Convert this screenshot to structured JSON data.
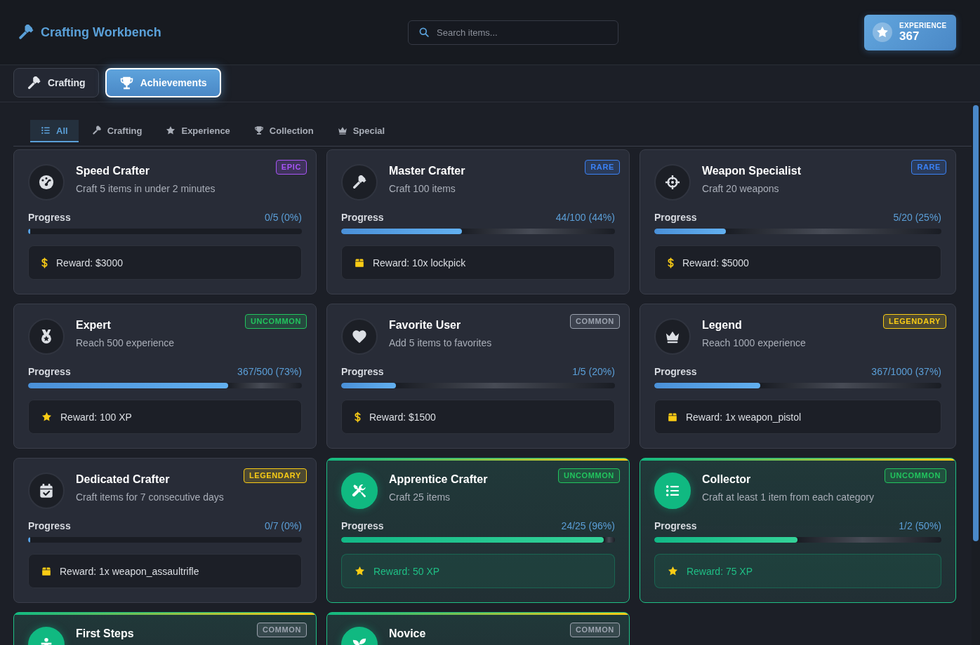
{
  "header": {
    "title": "Crafting Workbench",
    "search": {
      "placeholder": "Search items..."
    },
    "experience": {
      "label": "EXPERIENCE",
      "value": "367"
    }
  },
  "nav_tabs": [
    {
      "label": "Crafting",
      "selected": false
    },
    {
      "label": "Achievements",
      "selected": true
    }
  ],
  "filter_tabs": [
    {
      "label": "All",
      "selected": true
    },
    {
      "label": "Crafting",
      "selected": false
    },
    {
      "label": "Experience",
      "selected": false
    },
    {
      "label": "Collection",
      "selected": false
    },
    {
      "label": "Special",
      "selected": false
    }
  ],
  "achievements": [
    {
      "title": "Speed Crafter",
      "description": "Craft 5 items in under 2 minutes",
      "badge": {
        "text": "EPIC",
        "color": "#a855f7"
      },
      "highlighted": false,
      "progress": {
        "label": "Progress",
        "value": "0/5 (0%)",
        "level": 0
      },
      "reward": {
        "kind": "money",
        "text": "Reward: $3000"
      }
    },
    {
      "title": "Master Crafter",
      "description": "Craft 100 items",
      "badge": {
        "text": "RARE",
        "color": "#3b82f6"
      },
      "highlighted": false,
      "progress": {
        "label": "Progress",
        "value": "44/100 (44%)",
        "level": 0.44
      },
      "reward": {
        "kind": "item",
        "text": "Reward: 10x lockpick"
      }
    },
    {
      "title": "Weapon Specialist",
      "description": "Craft 20 weapons",
      "badge": {
        "text": "RARE",
        "color": "#3b82f6"
      },
      "highlighted": false,
      "progress": {
        "label": "Progress",
        "value": "5/20 (25%)",
        "level": 0.25
      },
      "reward": {
        "kind": "money",
        "text": "Reward: $5000"
      }
    },
    {
      "title": "Expert",
      "description": "Reach 500 experience",
      "badge": {
        "text": "UNCOMMON",
        "color": "#22c55e"
      },
      "highlighted": false,
      "progress": {
        "label": "Progress",
        "value": "367/500 (73%)",
        "level": 0.73
      },
      "reward": {
        "kind": "xp",
        "text": "Reward: 100 XP"
      }
    },
    {
      "title": "Favorite User",
      "description": "Add 5 items to favorites",
      "badge": {
        "text": "COMMON",
        "color": "#9ca3af"
      },
      "highlighted": false,
      "progress": {
        "label": "Progress",
        "value": "1/5 (20%)",
        "level": 0.2
      },
      "reward": {
        "kind": "money",
        "text": "Reward: $1500"
      }
    },
    {
      "title": "Legend",
      "description": "Reach 1000 experience",
      "badge": {
        "text": "LEGENDARY",
        "color": "#facc15"
      },
      "highlighted": false,
      "progress": {
        "label": "Progress",
        "value": "367/1000 (37%)",
        "level": 0.37
      },
      "reward": {
        "kind": "item",
        "text": "Reward: 1x weapon_pistol"
      }
    },
    {
      "title": "Dedicated Crafter",
      "description": "Craft items for 7 consecutive days",
      "badge": {
        "text": "LEGENDARY",
        "color": "#facc15"
      },
      "highlighted": false,
      "progress": {
        "label": "Progress",
        "value": "0/7 (0%)",
        "level": 0
      },
      "reward": {
        "kind": "item",
        "text": "Reward: 1x weapon_assaultrifle"
      }
    },
    {
      "title": "Apprentice Crafter",
      "description": "Craft 25 items",
      "badge": {
        "text": "UNCOMMON",
        "color": "#22c55e"
      },
      "highlighted": true,
      "progress": {
        "label": "Progress",
        "value": "24/25 (96%)",
        "level": 0.96
      },
      "reward": {
        "kind": "xp",
        "text": "Reward: 50 XP"
      }
    },
    {
      "title": "Collector",
      "description": "Craft at least 1 item from each category",
      "badge": {
        "text": "UNCOMMON",
        "color": "#22c55e"
      },
      "highlighted": true,
      "progress": {
        "label": "Progress",
        "value": "1/2 (50%)",
        "level": 0.5
      },
      "reward": {
        "kind": "xp",
        "text": "Reward: 75 XP"
      }
    },
    {
      "title": "First Steps",
      "badge": {
        "text": "COMMON",
        "color": "#9ca3af"
      },
      "highlighted": true
    },
    {
      "title": "Novice",
      "badge": {
        "text": "COMMON",
        "color": "#9ca3af"
      },
      "highlighted": true
    }
  ]
}
